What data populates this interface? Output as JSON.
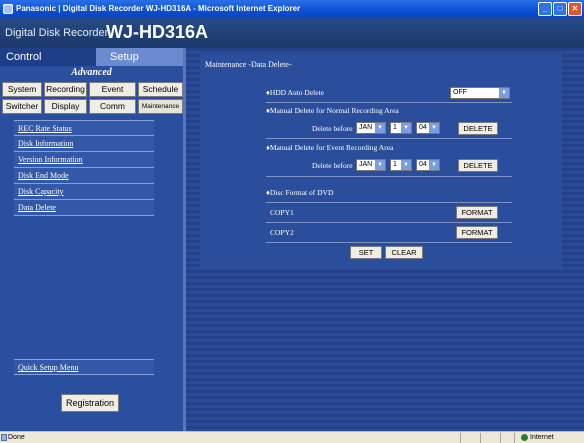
{
  "window": {
    "title": "Panasonic | Digital Disk Recorder WJ-HD316A - Microsoft Internet Explorer"
  },
  "header": {
    "subtitle": "Digital Disk Recorder",
    "model": "WJ-HD316A"
  },
  "tabs": {
    "control": "Control",
    "setup": "Setup"
  },
  "advanced_label": "Advanced",
  "categories": {
    "row1": [
      "System",
      "Recording",
      "Event",
      "Schedule"
    ],
    "row2": [
      "Switcher",
      "Display",
      "Comm",
      "Maintenance"
    ]
  },
  "menu": [
    "REC Rate Status",
    "Disk Information",
    "Version Information",
    "Disk End Mode",
    "Disk Capacity",
    "Data Delete"
  ],
  "quick_setup": "Quick Setup Menu",
  "registration": "Registration",
  "panel": {
    "title": "Maintenance -Data Delete-",
    "hdd_auto_delete": {
      "label": "♦HDD Auto Delete",
      "value": "OFF"
    },
    "normal": {
      "label": "♦Manual Delete for Normal Recording Area",
      "before": "Delete before",
      "month": "JAN",
      "day": "1",
      "year": "04",
      "button": "DELETE"
    },
    "event": {
      "label": "♦Manual Delete for Event Recording Area",
      "before": "Delete before",
      "month": "JAN",
      "day": "1",
      "year": "04",
      "button": "DELETE"
    },
    "disc_format": {
      "label": "♦Disc Format of DVD"
    },
    "copy1": {
      "label": "COPY1",
      "button": "FORMAT"
    },
    "copy2": {
      "label": "COPY2",
      "button": "FORMAT"
    },
    "set": "SET",
    "clear": "CLEAR"
  },
  "statusbar": {
    "left": "Done",
    "zone": "Internet"
  }
}
